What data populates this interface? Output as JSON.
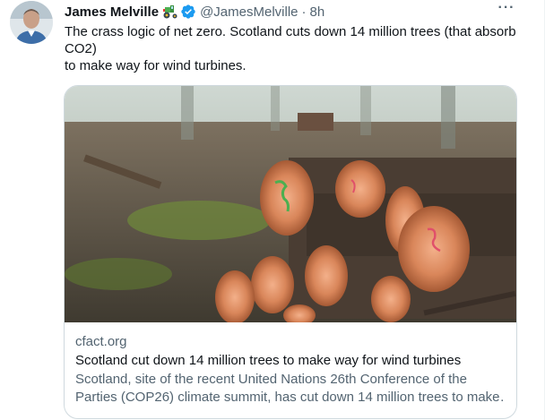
{
  "author": {
    "name": "James Melville",
    "emoji_name": "tractor-icon",
    "verified_icon": "verified-badge-icon",
    "handle": "@JamesMelville",
    "separator": "·",
    "time": "8h"
  },
  "menu": {
    "more_label": "···",
    "icon": "more-icon"
  },
  "tweet": {
    "line1": "The crass logic of net zero. Scotland cuts down 14 million trees (that absorb",
    "line2": "CO2)",
    "line3": "to make way for wind turbines."
  },
  "card": {
    "domain": "cfact.org",
    "title": "Scotland cut down 14 million trees to make way for wind turbines",
    "desc_line1": "Scotland, site of the recent United Nations 26th Conference of the",
    "desc_line2": "Parties (COP26) climate summit, has cut down 14 million trees to make…"
  },
  "colors": {
    "text": "#0f1419",
    "secondary": "#536471",
    "verified": "#1d9bf0",
    "border": "#cfd9de"
  }
}
